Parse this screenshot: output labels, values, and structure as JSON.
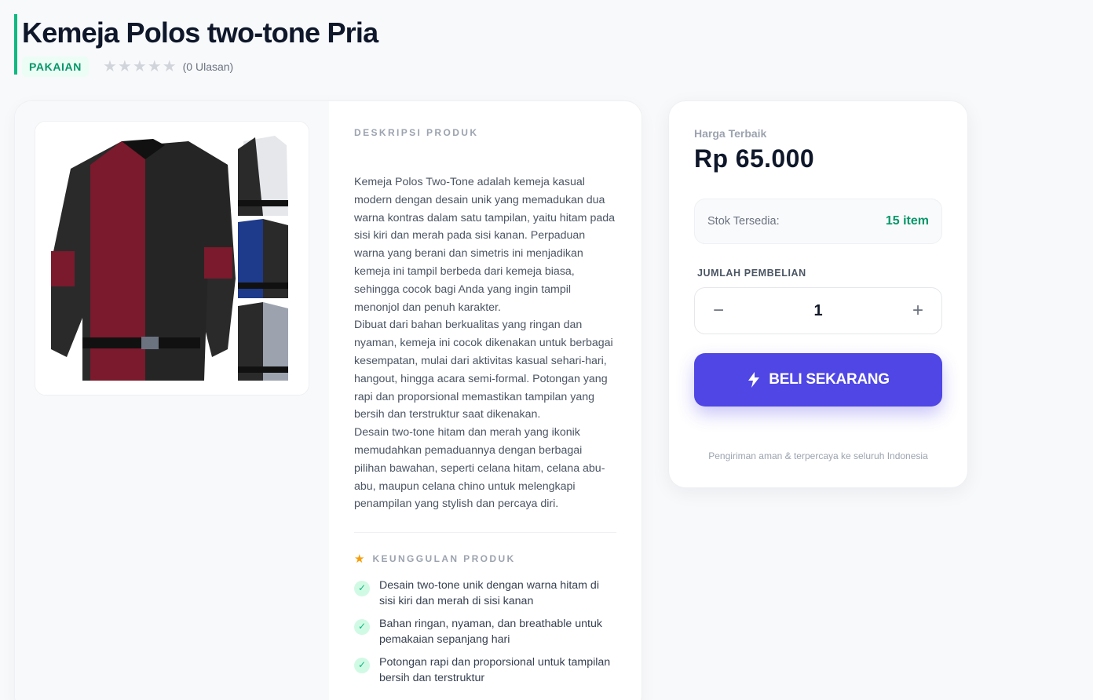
{
  "product": {
    "title": "Kemeja Polos two-tone Pria",
    "category": "PAKAIAN",
    "rating_stars": 0,
    "review_count": "(0 Ulasan)"
  },
  "description": {
    "label": "DESKRIPSI PRODUK",
    "text": "Kemeja Polos Two-Tone adalah kemeja kasual modern dengan desain unik yang memadukan dua warna kontras dalam satu tampilan, yaitu hitam pada sisi kiri dan merah pada sisi kanan. Perpaduan warna yang berani dan simetris ini menjadikan kemeja ini tampil berbeda dari kemeja biasa, sehingga cocok bagi Anda yang ingin tampil menonjol dan penuh karakter.\nDibuat dari bahan berkualitas yang ringan dan nyaman, kemeja ini cocok dikenakan untuk berbagai kesempatan, mulai dari aktivitas kasual sehari-hari, hangout, hingga acara semi-formal. Potongan yang rapi dan proporsional memastikan tampilan yang bersih dan terstruktur saat dikenakan.\nDesain two-tone hitam dan merah yang ikonik memudahkan pemaduannya dengan berbagai pilihan bawahan, seperti celana hitam, celana abu-abu, maupun celana chino untuk melengkapi penampilan yang stylish dan percaya diri."
  },
  "features": {
    "label": "KEUNGGULAN PRODUK",
    "items": [
      "Desain two-tone unik dengan warna hitam di sisi kiri dan merah di sisi kanan",
      "Bahan ringan, nyaman, dan breathable untuk pemakaian sepanjang hari",
      "Potongan rapi dan proporsional untuk tampilan bersih dan terstruktur"
    ]
  },
  "purchase": {
    "price_label": "Harga Terbaik",
    "price": "Rp 65.000",
    "stock_label": "Stok Tersedia:",
    "stock_value": "15 item",
    "qty_label": "JUMLAH PEMBELIAN",
    "qty_value": "1",
    "minus": "−",
    "plus": "+",
    "buy_label": "BELI SEKARANG",
    "shipping_note": "Pengiriman aman & terpercaya ke seluruh Indonesia"
  },
  "colors": {
    "accent": "#10b981",
    "primary": "#4f46e5"
  },
  "icons": [
    "star-icon",
    "check-icon",
    "lightning-icon",
    "minus-icon",
    "plus-icon"
  ]
}
